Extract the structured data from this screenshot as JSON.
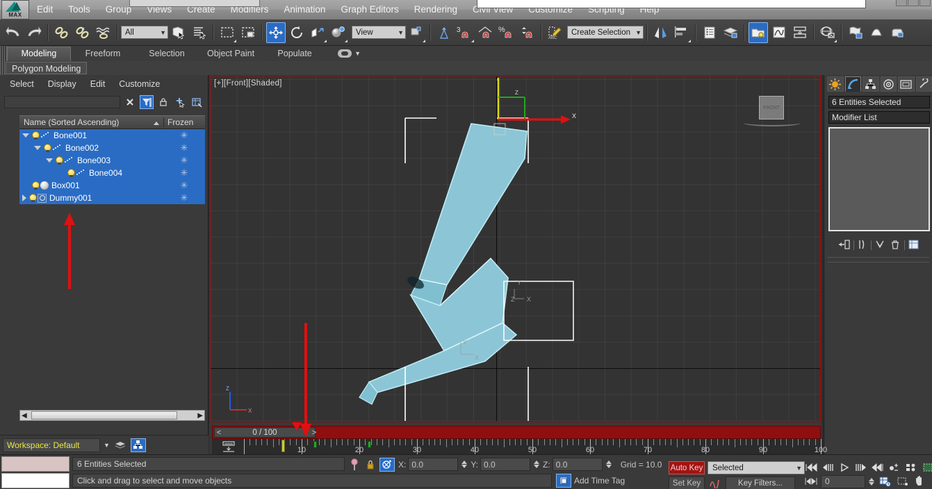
{
  "app": {
    "logo_label": "MAX"
  },
  "menubar": {
    "items": [
      "Edit",
      "Tools",
      "Group",
      "Views",
      "Create",
      "Modifiers",
      "Animation",
      "Graph Editors",
      "Rendering",
      "Civil View",
      "Customize",
      "Scripting",
      "Help"
    ]
  },
  "main_toolbar": {
    "selection_filter": "All",
    "reference_coordinate": "View",
    "named_selection_set": "Create Selection Set",
    "snap_percent_label": "%",
    "snap_count_label": "3",
    "buttons": [
      "undo",
      "redo",
      "select-and-link",
      "unlink-selection",
      "bind-to-space-warp",
      "select-object",
      "select-by-name",
      "rectangular-selection-region",
      "window-crossing",
      "select-and-move",
      "select-and-rotate",
      "select-and-scale",
      "select-and-place",
      "snaps-toggle",
      "angle-snap-toggle",
      "percent-snap-toggle",
      "spinner-snap-toggle",
      "edit-named-selection-sets",
      "mirror",
      "align",
      "layer-explorer",
      "ribbon-toggle",
      "curve-editor",
      "schematic-view",
      "material-editor",
      "render-setup",
      "rendered-frame-window",
      "render-production",
      "material-explorer"
    ]
  },
  "ribbon": {
    "tabs": [
      "Modeling",
      "Freeform",
      "Selection",
      "Object Paint",
      "Populate"
    ],
    "active_tab": "Modeling",
    "panel": "Polygon Modeling"
  },
  "scene_explorer": {
    "menu": [
      "Select",
      "Display",
      "Edit",
      "Customize"
    ],
    "search_value": "",
    "columns": [
      "Name (Sorted Ascending)",
      "Frozen"
    ],
    "rows": [
      {
        "name": "Bone001",
        "indent": 0,
        "toggle": "open",
        "icon": "bone",
        "selected": true,
        "frozen": "*"
      },
      {
        "name": "Bone002",
        "indent": 1,
        "toggle": "open",
        "icon": "bone",
        "selected": true,
        "frozen": "*"
      },
      {
        "name": "Bone003",
        "indent": 2,
        "toggle": "open",
        "icon": "bone",
        "selected": true,
        "frozen": "*"
      },
      {
        "name": "Bone004",
        "indent": 3,
        "toggle": "none",
        "icon": "bone",
        "selected": true,
        "frozen": "*"
      },
      {
        "name": "Box001",
        "indent": 0,
        "toggle": "none",
        "icon": "sphere",
        "selected": true,
        "frozen": "*"
      },
      {
        "name": "Dummy001",
        "indent": 0,
        "toggle": "closed",
        "icon": "dummy",
        "selected": true,
        "frozen": "*"
      }
    ],
    "workspace_label": "Workspace: Default"
  },
  "viewport": {
    "label": "[+][Front][Shaded]",
    "viewcube_face": "FRONT",
    "axis_x": "X",
    "axis_y": "Y",
    "axis_z": "Z",
    "mesh_color": "#8cc6d6",
    "border_color": "#8d1111"
  },
  "command_panel": {
    "tabs": [
      "create",
      "modify",
      "hierarchy",
      "motion",
      "display",
      "utilities"
    ],
    "active_tab": "modify",
    "selection_label": "6 Entities Selected",
    "modifier_list_label": "Modifier List",
    "stack_items": []
  },
  "timeline": {
    "slider_label": "0 / 100",
    "prev_arrow": "<",
    "next_arrow": ">",
    "tick_labels": [
      "10",
      "20",
      "30",
      "40",
      "50",
      "60",
      "70",
      "80",
      "90",
      "100"
    ],
    "range_start": 0,
    "range_end": 100
  },
  "status": {
    "selection_text": "6 Entities Selected",
    "prompt_text": "Click and drag to select and move objects",
    "x_label": "X:",
    "x_value": "0.0",
    "y_label": "Y:",
    "y_value": "0.0",
    "z_label": "Z:",
    "z_value": "0.0",
    "grid_label": "Grid = 10.0",
    "add_time_tag": "Add Time Tag"
  },
  "animation": {
    "auto_key": "Auto Key",
    "set_key": "Set Key",
    "key_mode": "Selected",
    "key_filters": "Key Filters...",
    "current_frame": "0"
  },
  "colors": {
    "accent_blue": "#2a6cc4",
    "timeline_red": "#8f0f0f",
    "annotation_red": "#e01010",
    "workspace_yellow": "#e8e84a",
    "autokey_red": "#a31313"
  }
}
